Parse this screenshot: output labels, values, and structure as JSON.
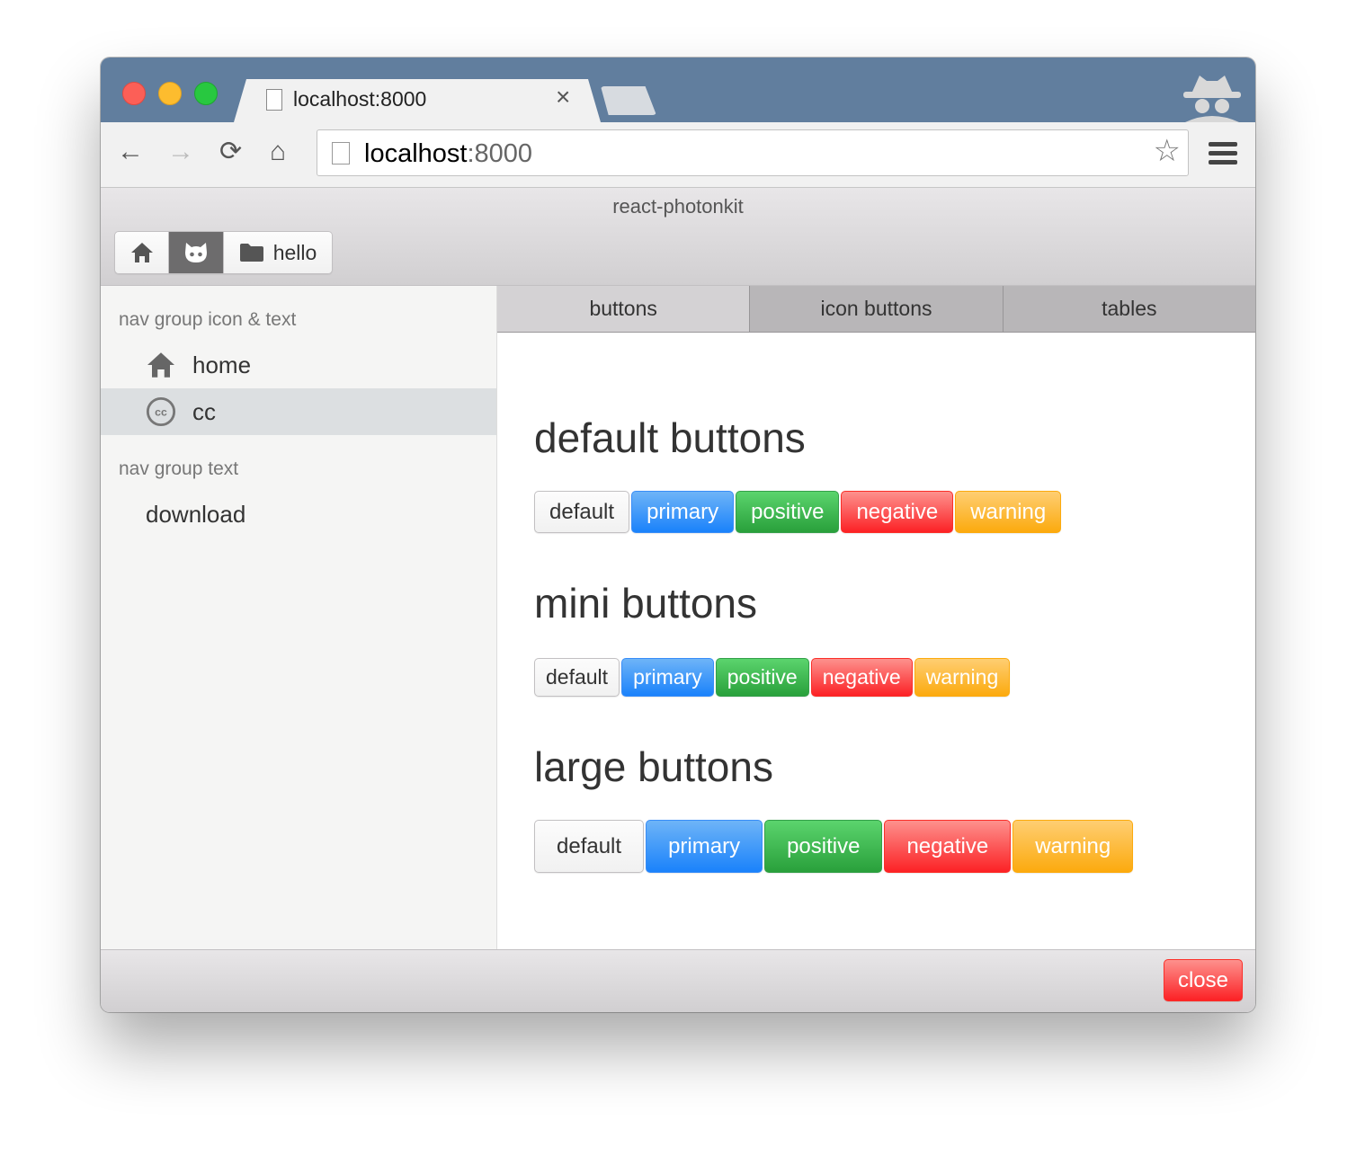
{
  "browser": {
    "tab_title": "localhost:8000",
    "tab_close": "×",
    "url_host": "localhost",
    "url_port": ":8000",
    "nav": {
      "back": "←",
      "forward": "→",
      "reload": "⟳",
      "home": "⌂"
    },
    "star": "☆"
  },
  "app": {
    "title": "react-photonkit",
    "header_button_group": [
      {
        "icon": "home-icon"
      },
      {
        "icon": "github-icon",
        "active": true
      },
      {
        "icon": "folder-icon",
        "label": "hello"
      }
    ]
  },
  "sidebar": {
    "groups": [
      {
        "title": "nav group icon & text",
        "items": [
          {
            "icon": "home-icon",
            "label": "home"
          },
          {
            "icon": "cc-icon",
            "label": "cc",
            "active": true
          }
        ]
      },
      {
        "title": "nav group text",
        "items": [
          {
            "label": "download"
          }
        ]
      }
    ]
  },
  "tabs": [
    {
      "label": "buttons",
      "active": true
    },
    {
      "label": "icon buttons"
    },
    {
      "label": "tables"
    }
  ],
  "sections": [
    {
      "heading": "default buttons",
      "buttons": [
        "default",
        "primary",
        "positive",
        "negative",
        "warning"
      ]
    },
    {
      "heading": "mini buttons",
      "buttons": [
        "default",
        "primary",
        "positive",
        "negative",
        "warning"
      ]
    },
    {
      "heading": "large buttons",
      "buttons": [
        "default",
        "primary",
        "positive",
        "negative",
        "warning"
      ]
    }
  ],
  "footer": {
    "close_label": "close"
  },
  "colors": {
    "primary": "#1a82fb",
    "positive": "#34c84a",
    "negative": "#fc605b",
    "warning": "#fdbc40",
    "tabstrip": "#617e9e"
  }
}
